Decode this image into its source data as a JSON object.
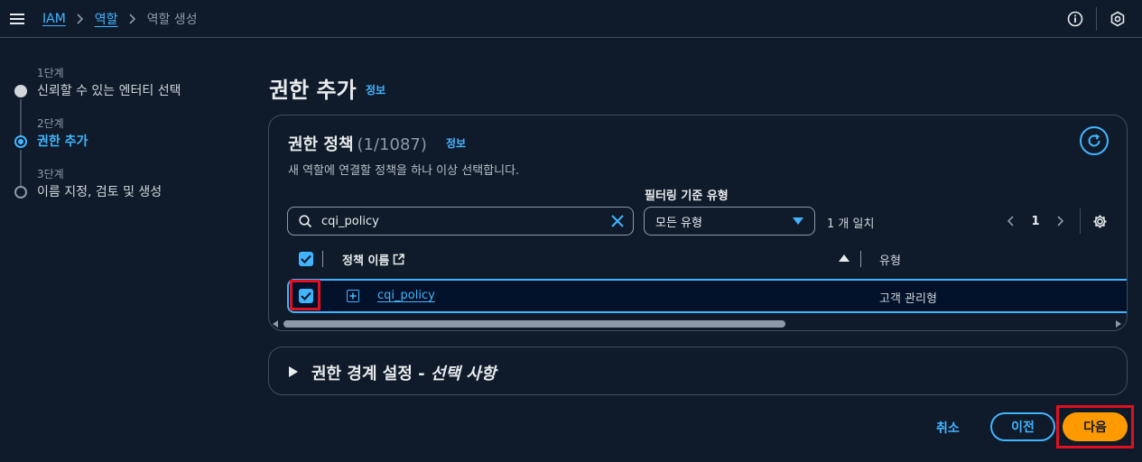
{
  "topbar": {
    "breadcrumb": [
      {
        "label": "IAM"
      },
      {
        "label": "역할"
      },
      {
        "label": "역할 생성"
      }
    ]
  },
  "steps": [
    {
      "num": "1단계",
      "title": "신뢰할 수 있는 엔터티 선택",
      "state": "done"
    },
    {
      "num": "2단계",
      "title": "권한 추가",
      "state": "active"
    },
    {
      "num": "3단계",
      "title": "이름 지정, 검토 및 생성",
      "state": "pending"
    }
  ],
  "page": {
    "title": "권한 추가",
    "info": "정보"
  },
  "policies": {
    "title": "권한 정책",
    "count": "(1/1087)",
    "info": "정보",
    "description": "새 역할에 연결할 정책을 하나 이상 선택합니다.",
    "filter_label": "필터링 기준 유형",
    "search_value": "cqi_policy",
    "type_select": "모든 유형",
    "match_text": "1 개 일치",
    "page_number": "1",
    "columns": {
      "name": "정책 이름",
      "type": "유형"
    },
    "rows": [
      {
        "name": "cqi_policy",
        "type": "고객 관리형",
        "selected": true
      }
    ]
  },
  "boundary": {
    "title": "권한 경계 설정 - ",
    "title_italic": "선택 사항"
  },
  "footer": {
    "cancel": "취소",
    "previous": "이전",
    "next": "다음"
  },
  "colors": {
    "accent": "#42b4ff",
    "primary_button": "#ff9900",
    "highlight": "#e01020",
    "background": "#0f1b2a"
  }
}
